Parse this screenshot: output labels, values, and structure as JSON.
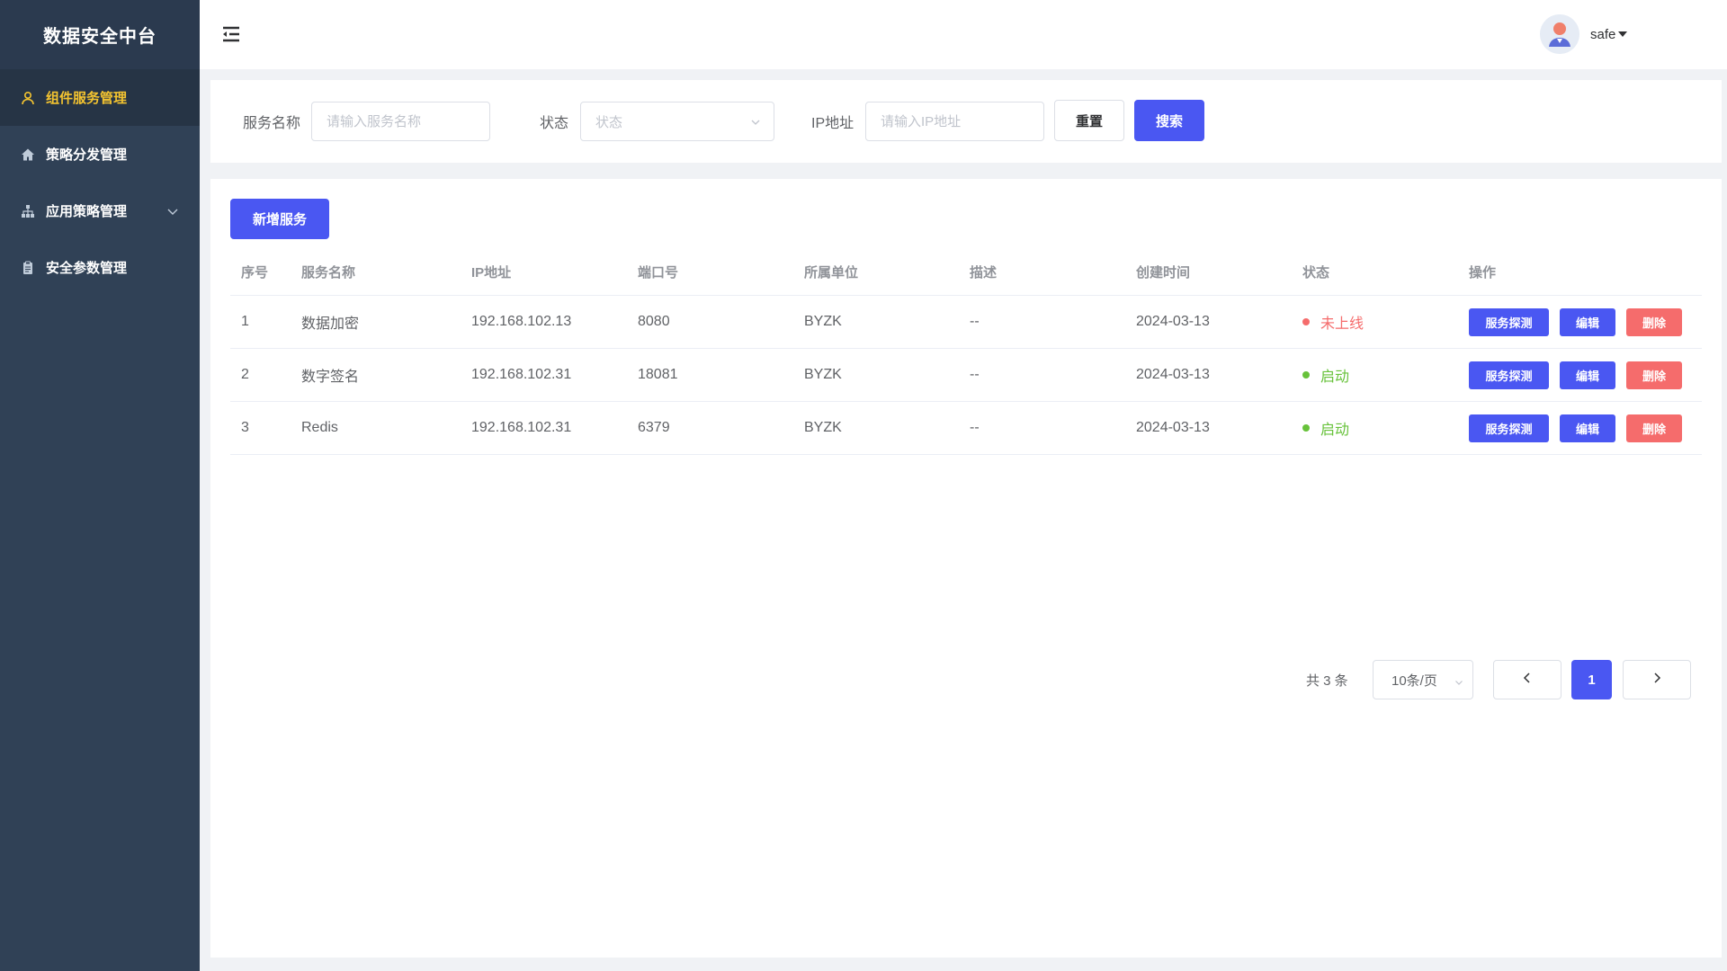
{
  "app": {
    "title": "数据安全中台"
  },
  "sidebar": {
    "items": [
      {
        "label": "组件服务管理",
        "icon": "user-icon",
        "active": true
      },
      {
        "label": "策略分发管理",
        "icon": "home-icon"
      },
      {
        "label": "应用策略管理",
        "icon": "sitemap-icon",
        "has_children": true
      },
      {
        "label": "安全参数管理",
        "icon": "clipboard-icon"
      }
    ]
  },
  "header": {
    "username": "safe"
  },
  "search": {
    "service_name_label": "服务名称",
    "service_name_placeholder": "请输入服务名称",
    "status_label": "状态",
    "status_placeholder": "状态",
    "ip_label": "IP地址",
    "ip_placeholder": "请输入IP地址",
    "reset_label": "重置",
    "search_label": "搜索"
  },
  "toolbar": {
    "add_label": "新增服务"
  },
  "table": {
    "columns": [
      "序号",
      "服务名称",
      "IP地址",
      "端口号",
      "所属单位",
      "描述",
      "创建时间",
      "状态",
      "操作"
    ],
    "rows": [
      {
        "index": "1",
        "name": "数据加密",
        "ip": "192.168.102.13",
        "port": "8080",
        "unit": "BYZK",
        "desc": "--",
        "created": "2024-03-13",
        "status": "未上线",
        "status_color": "#f56c6c"
      },
      {
        "index": "2",
        "name": "数字签名",
        "ip": "192.168.102.31",
        "port": "18081",
        "unit": "BYZK",
        "desc": "--",
        "created": "2024-03-13",
        "status": "启动",
        "status_color": "#67c23a"
      },
      {
        "index": "3",
        "name": "Redis",
        "ip": "192.168.102.31",
        "port": "6379",
        "unit": "BYZK",
        "desc": "--",
        "created": "2024-03-13",
        "status": "启动",
        "status_color": "#67c23a"
      }
    ],
    "actions": {
      "probe": "服务探测",
      "edit": "编辑",
      "delete": "删除"
    }
  },
  "pagination": {
    "total": "共 3 条",
    "page_size": "10条/页",
    "current_page": "1"
  },
  "colors": {
    "primary": "#4a57f2",
    "danger": "#f56c6c",
    "success": "#67c23a",
    "sidebar_bg": "#304156",
    "active_text": "#f4c430"
  }
}
